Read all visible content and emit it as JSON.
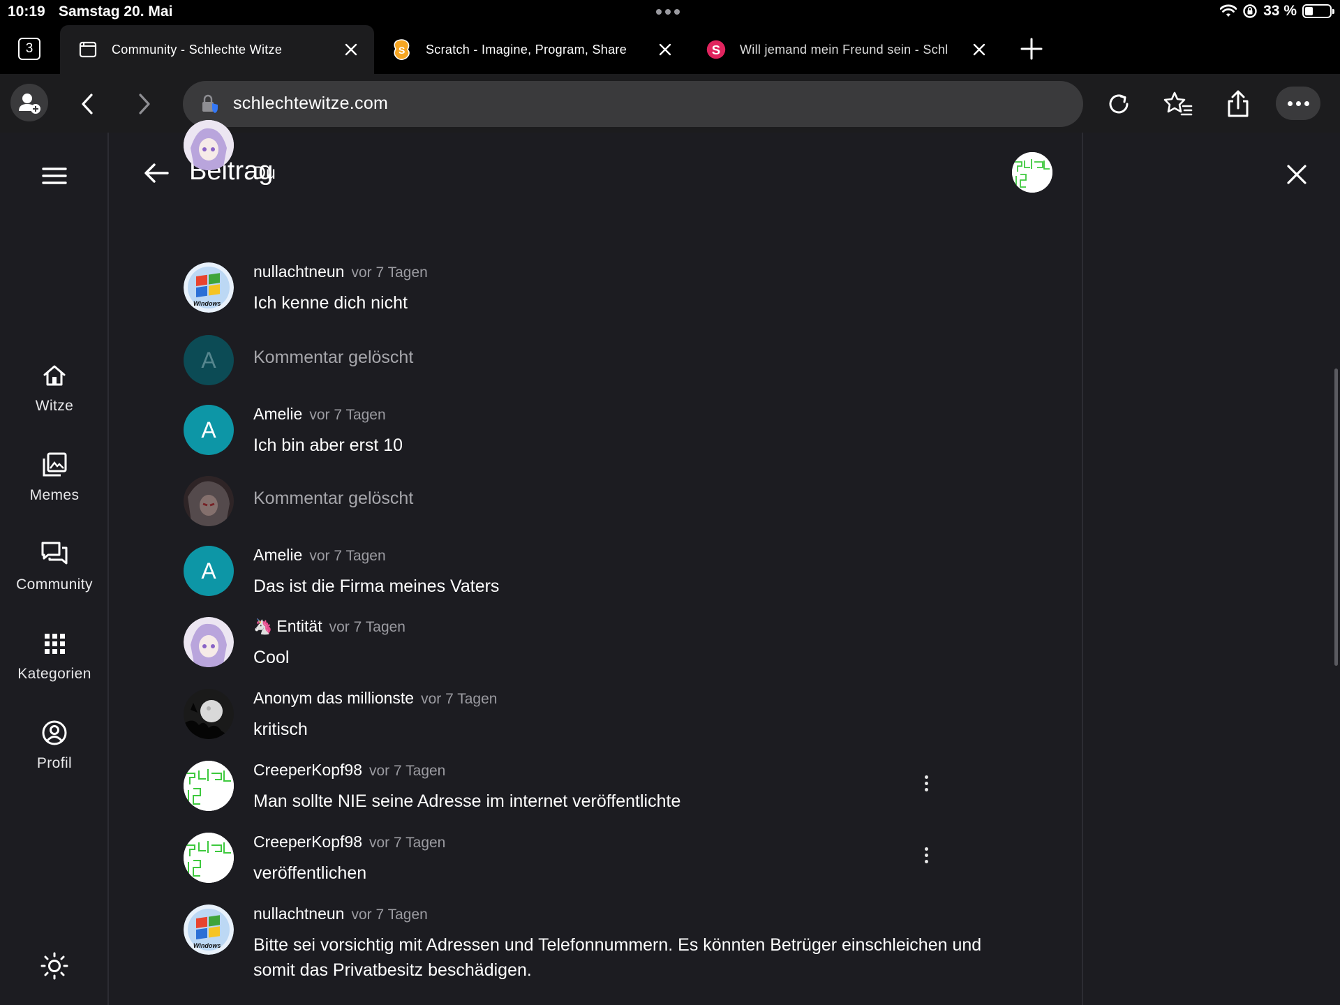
{
  "status_bar": {
    "time": "10:19",
    "date": "Samstag 20. Mai",
    "battery": "33 %",
    "battery_level": 0.33
  },
  "tabs": {
    "count": "3",
    "items": [
      {
        "title": "Community - Schlechte Witze",
        "icon": "page-icon",
        "active": true
      },
      {
        "title": "Scratch - Imagine, Program, Share",
        "icon": "scratch-icon",
        "active": false
      },
      {
        "title": "Will jemand mein Freund sein - Schl",
        "icon": "s-logo-icon",
        "active": false
      }
    ]
  },
  "toolbar": {
    "url": "schlechtewitze.com"
  },
  "sidebar": {
    "items": [
      {
        "label": "Witze",
        "icon": "home-icon"
      },
      {
        "label": "Memes",
        "icon": "image-icon"
      },
      {
        "label": "Community",
        "icon": "chat-icon"
      },
      {
        "label": "Kategorien",
        "icon": "grid-icon"
      },
      {
        "label": "Profil",
        "icon": "profile-icon"
      }
    ]
  },
  "header": {
    "title": "Beitrag"
  },
  "comments": [
    {
      "author": "",
      "time": "",
      "text": "Du",
      "avatar": "anime-avatar"
    },
    {
      "author": "nullachtneun",
      "time": "vor 7 Tagen",
      "text": "Ich kenne dich nicht",
      "avatar": "windows-avatar"
    },
    {
      "author": "",
      "time": "",
      "text": "Kommentar gelöscht",
      "avatar": "letter-avatar",
      "avatar_letter": "A",
      "deleted": true
    },
    {
      "author": "Amelie",
      "time": "vor 7 Tagen",
      "text": "Ich bin aber erst 10",
      "avatar": "letter-avatar",
      "avatar_letter": "A"
    },
    {
      "author": "",
      "time": "",
      "text": "Kommentar gelöscht",
      "avatar": "dark-character-avatar",
      "deleted": true
    },
    {
      "author": "Amelie",
      "time": "vor 7 Tagen",
      "text": "Das ist die Firma meines Vaters",
      "avatar": "letter-avatar",
      "avatar_letter": "A"
    },
    {
      "author": "Entität",
      "author_badge": "🦄",
      "time": "vor 7 Tagen",
      "text": "Cool",
      "avatar": "anime-avatar"
    },
    {
      "author": "Anonym das millionste",
      "time": "vor 7 Tagen",
      "text": "kritisch",
      "avatar": "moon-avatar"
    },
    {
      "author": "CreeperKopf98",
      "time": "vor 7 Tagen",
      "text": "Man sollte NIE seine Adresse im internet veröffentlichte",
      "avatar": "creeper-avatar",
      "menu": true
    },
    {
      "author": "CreeperKopf98",
      "time": "vor 7 Tagen",
      "text": "veröffentlichen",
      "avatar": "creeper-avatar",
      "menu": true
    },
    {
      "author": "nullachtneun",
      "time": "vor 7 Tagen",
      "text": "Bitte sei vorsichtig mit Adressen und Telefonnummern. Es könnten Betrüger einschleichen und somit das Privatbesitz beschädigen.",
      "avatar": "windows-avatar"
    }
  ],
  "colors": {
    "background": "#1c1c21",
    "teal_avatar": "#0d96a6",
    "teal_avatar_dim": "#0c4b55",
    "muted_text": "#9b9ba1"
  }
}
